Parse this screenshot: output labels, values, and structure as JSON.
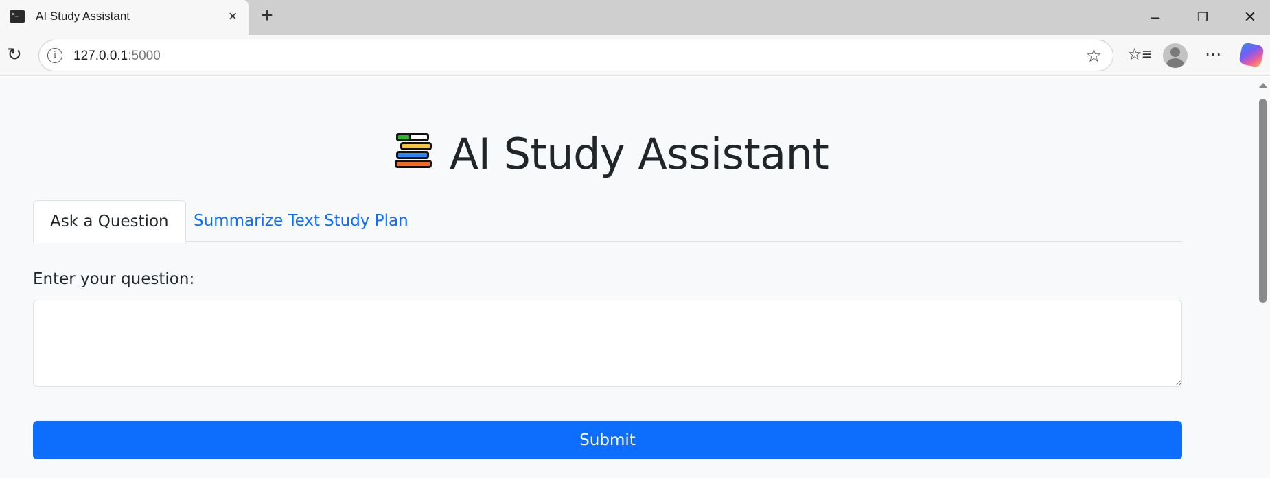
{
  "browser": {
    "tab_title": "AI Study Assistant",
    "close_icon": "close-icon",
    "new_tab_icon": "plus-icon",
    "url_host": "127.0.0.1",
    "url_port": ":5000",
    "window_controls": [
      "minimize-icon",
      "restore-icon",
      "close-icon"
    ]
  },
  "page": {
    "title": "AI Study Assistant",
    "title_icon": "books-icon",
    "tabs": [
      {
        "label": "Ask a Question",
        "active": true
      },
      {
        "label": "Summarize Text",
        "active": false
      },
      {
        "label": "Study Plan",
        "active": false
      }
    ],
    "question_label": "Enter your question:",
    "question_value": "",
    "submit_label": "Submit"
  },
  "colors": {
    "accent": "#0d6efd",
    "page_background": "#f8f9fa",
    "text": "#212529"
  }
}
